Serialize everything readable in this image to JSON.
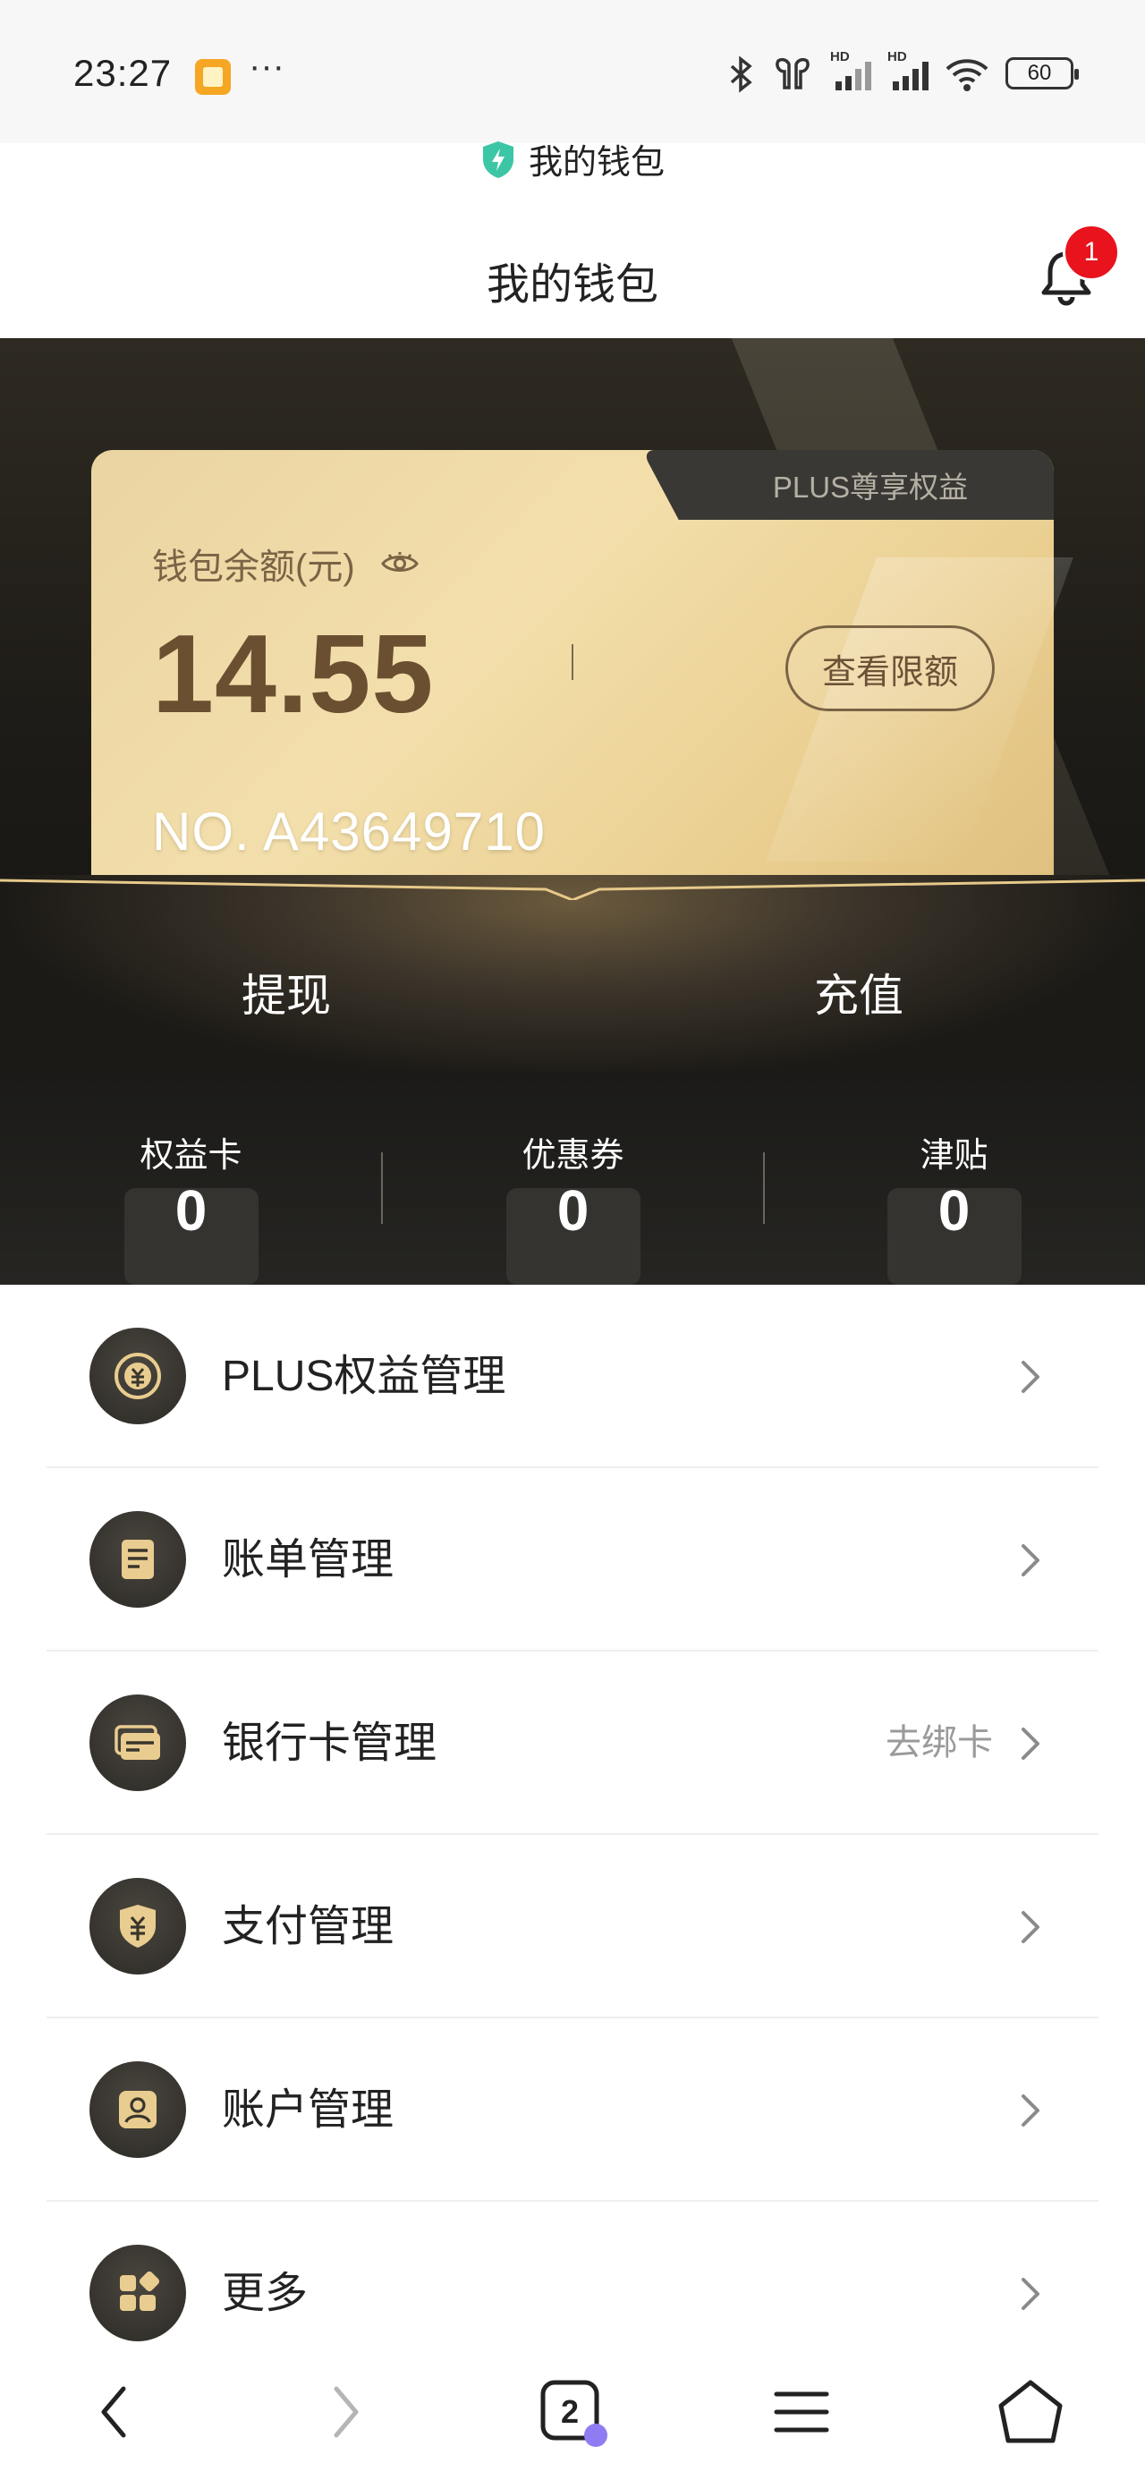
{
  "status_bar": {
    "time": "23:27",
    "dots": "···",
    "battery": "60",
    "icons": [
      "notification-icon",
      "bluetooth-icon",
      "earbuds-icon",
      "signal-hd-icon",
      "signal-hd-icon",
      "wifi-icon",
      "battery-icon"
    ]
  },
  "browser": {
    "url_title": "我的钱包",
    "icon": "shield-icon"
  },
  "header": {
    "title": "我的钱包",
    "notification_count": "1"
  },
  "card": {
    "tab_label": "PLUS尊享权益",
    "balance_label": "钱包余额(元)",
    "balance": "14.55",
    "limit_button": "查看限额",
    "number": "NO. A43649710"
  },
  "actions": {
    "withdraw": "提现",
    "recharge": "充值"
  },
  "stats": [
    {
      "label": "权益卡",
      "value": "0"
    },
    {
      "label": "优惠券",
      "value": "0"
    },
    {
      "label": "津贴",
      "value": "0"
    }
  ],
  "menu": [
    {
      "label": "PLUS权益管理",
      "hint": "",
      "icon": "plus-coin-icon"
    },
    {
      "label": "账单管理",
      "hint": "",
      "icon": "bill-icon"
    },
    {
      "label": "银行卡管理",
      "hint": "去绑卡",
      "icon": "bank-card-icon"
    },
    {
      "label": "支付管理",
      "hint": "",
      "icon": "payment-shield-icon"
    },
    {
      "label": "账户管理",
      "hint": "",
      "icon": "account-icon"
    },
    {
      "label": "更多",
      "hint": "",
      "icon": "more-grid-icon"
    }
  ],
  "bottom_nav": {
    "tab_count": "2",
    "items": [
      "back-icon",
      "forward-icon",
      "tabs-icon",
      "menu-icon",
      "home-icon"
    ]
  },
  "colors": {
    "gold": "#ead5a2",
    "dark": "#1d1b17",
    "badge_red": "#e8131d",
    "brown_text": "#6b4f31"
  }
}
